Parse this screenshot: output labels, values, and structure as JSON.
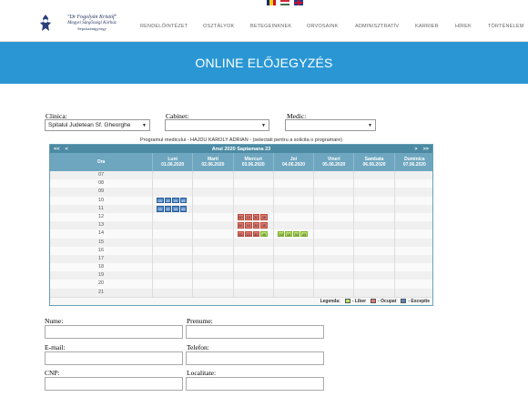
{
  "header": {
    "logo": {
      "line1": "\"Dr Fogolyán Kristóf\"",
      "line2": "Megyei Sürgősségi Kórház",
      "line3": "Sepsiszentgyörgy"
    },
    "flags": [
      "ro",
      "hu",
      "gb"
    ],
    "nav": [
      "RENDELŐINTÉZET",
      "OSZTÁLYOK",
      "BETEGEINKNEK",
      "ORVOSAINK",
      "ADMINISZTRATÍV",
      "KARRIER",
      "HÍREK",
      "TÖRTÉNELEM"
    ]
  },
  "banner": {
    "title": "ONLINE ELŐJEGYZÉS",
    "color": "#2a97d4"
  },
  "filters": {
    "clinica": {
      "label": "Clinica:",
      "value": "Spitalul Judetean Sf. Gheorghe"
    },
    "cabinet": {
      "label": "Cabinet:",
      "value": ""
    },
    "medic": {
      "label": "Medic:",
      "value": ""
    }
  },
  "calendar": {
    "caption": "Programul medicului - HAJDU KAROLY ADRIAN - (selectati pentru a solicita o programare)",
    "nav_prev2": "<<",
    "nav_prev": "<",
    "nav_next": ">",
    "nav_next2": ">>",
    "title": "Anul 2020 Saptamana 23",
    "hour_header": "Ora",
    "days": [
      {
        "name": "Luni",
        "date": "01.06.2020"
      },
      {
        "name": "Marti",
        "date": "02.06.2020"
      },
      {
        "name": "Miercuri",
        "date": "03.06.2020"
      },
      {
        "name": "Joi",
        "date": "04.06.2020"
      },
      {
        "name": "Vineri",
        "date": "05.06.2020"
      },
      {
        "name": "Sambata",
        "date": "06.06.2020"
      },
      {
        "name": "Duminica",
        "date": "07.06.2020"
      }
    ],
    "hours": [
      "07",
      "08",
      "09",
      "10",
      "11",
      "12",
      "13",
      "14",
      "15",
      "16",
      "17",
      "18",
      "19",
      "20",
      "21"
    ],
    "slots": {
      "10": {
        "0": [
          [
            "00",
            "blue"
          ],
          [
            "15",
            "blue"
          ],
          [
            "30",
            "blue"
          ],
          [
            "45",
            "blue"
          ]
        ]
      },
      "11": {
        "0": [
          [
            "00",
            "blue"
          ],
          [
            "15",
            "blue"
          ],
          [
            "30",
            "blue"
          ],
          [
            "45",
            "blue"
          ]
        ]
      },
      "12": {
        "2": [
          [
            "00",
            "red"
          ],
          [
            "15",
            "red"
          ],
          [
            "30",
            "red"
          ],
          [
            "45",
            "red"
          ]
        ]
      },
      "13": {
        "2": [
          [
            "00",
            "red"
          ],
          [
            "15",
            "red"
          ],
          [
            "30",
            "red"
          ],
          [
            "45",
            "red"
          ]
        ]
      },
      "14": {
        "2": [
          [
            "00",
            "red"
          ],
          [
            "15",
            "red"
          ],
          [
            "30",
            "red"
          ],
          [
            "45",
            "green"
          ]
        ],
        "3": [
          [
            "00",
            "green"
          ],
          [
            "15",
            "green"
          ],
          [
            "30",
            "green"
          ],
          [
            "45",
            "green"
          ]
        ]
      }
    },
    "legend": {
      "label": "Legenda:",
      "items": [
        {
          "color": "#b9e86a",
          "text": "- Liber"
        },
        {
          "color": "#e47a6e",
          "text": "- Ocupat"
        },
        {
          "color": "#4f86c6",
          "text": "- Exceptie"
        }
      ]
    }
  },
  "form": {
    "nume": {
      "label": "Nume:",
      "value": ""
    },
    "prenume": {
      "label": "Prenume:",
      "value": ""
    },
    "email": {
      "label": "E-mail:",
      "value": ""
    },
    "telefon": {
      "label": "Telefon:",
      "value": ""
    },
    "cnp": {
      "label": "CNP:",
      "value": ""
    },
    "localitate": {
      "label": "Localitate:",
      "value": ""
    }
  }
}
